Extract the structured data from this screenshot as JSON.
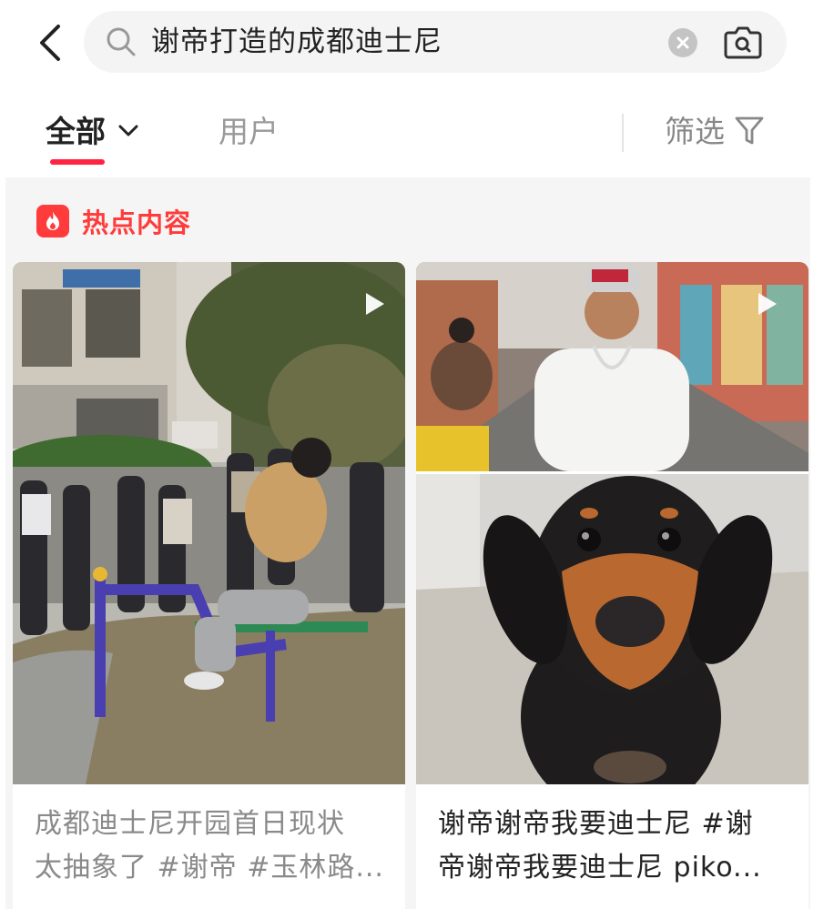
{
  "search": {
    "query": "谢帝打造的成都迪士尼"
  },
  "tabs": {
    "all_label": "全部",
    "user_label": "用户",
    "filter_label": "筛选"
  },
  "section": {
    "hot_label": "热点内容"
  },
  "cards": [
    {
      "title_line1": "成都迪士尼开园首日现状",
      "title_line2": "太抽象了 #谢帝 #玉林路..."
    },
    {
      "title_line1": "谢帝谢帝我要迪士尼 #谢",
      "title_line2": "帝谢帝我要迪士尼  piko..."
    }
  ],
  "colors": {
    "accent": "#ff2442",
    "hot": "#ff3b3b"
  },
  "icons": {
    "back": "chevron-left-icon",
    "search": "search-icon",
    "clear": "clear-icon",
    "camera": "camera-search-icon",
    "dropdown": "chevron-down-icon",
    "filter": "filter-icon",
    "hot": "flame-icon",
    "play": "play-icon"
  }
}
